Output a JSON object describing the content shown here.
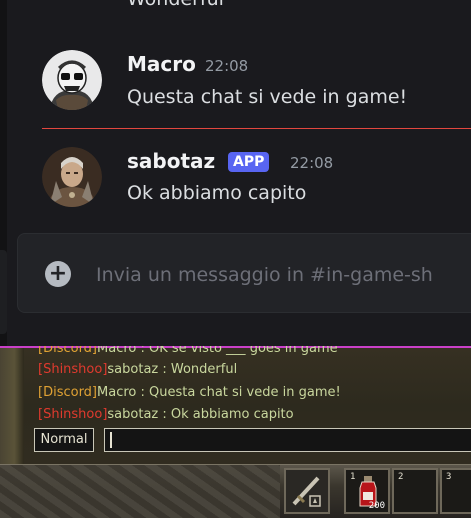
{
  "discord": {
    "cutoff_text": "Wonderful",
    "messages": [
      {
        "username": "Macro",
        "time": "22:08",
        "text": "Questa chat si vede in game!"
      },
      {
        "username": "sabotaz",
        "badge": "APP",
        "time": "22:08",
        "text": "Ok abbiamo capito"
      }
    ],
    "composer": {
      "placeholder": "Invia un messaggio in #in-game-sh"
    },
    "colors": {
      "background": "#1a1a1e",
      "divider": "#e2473f",
      "badge": "#5865f2",
      "text": "#dbdee1"
    }
  },
  "game": {
    "chat_lines": [
      {
        "tag": "[Discord]",
        "tag_color": "orange",
        "text": "Macro : OK se visto ___ goes in game"
      },
      {
        "tag": "[Shinshoo]",
        "tag_color": "red",
        "text": "sabotaz :  Wonderful"
      },
      {
        "tag": "[Discord]",
        "tag_color": "orange",
        "text": "Macro : Questa chat si vede in game!"
      },
      {
        "tag": "[Shinshoo]",
        "tag_color": "red",
        "text": "sabotaz : Ok abbiamo capito"
      }
    ],
    "chat_type_label": "Normal",
    "hotbar": {
      "slots": [
        {
          "number": "",
          "item": "sword-icon",
          "qty": ""
        },
        {
          "number": "1",
          "item": "red-potion-icon",
          "qty": "200"
        },
        {
          "number": "2",
          "item": "",
          "qty": ""
        },
        {
          "number": "3",
          "item": "",
          "qty": ""
        }
      ]
    }
  }
}
